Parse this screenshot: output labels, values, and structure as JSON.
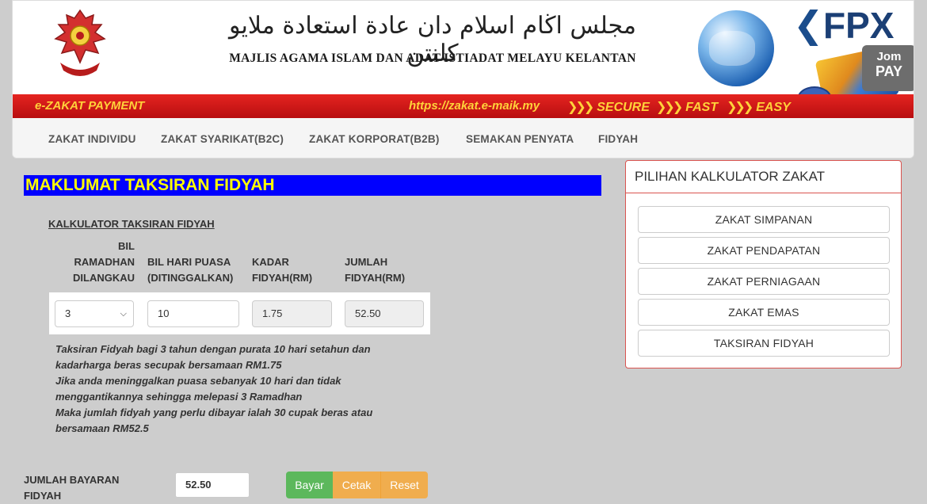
{
  "header": {
    "jawi_title": "مجلس اڬام اسلام دان عادة استعادة ملايو كلنتن",
    "org_name": "MAJLIS AGAMA ISLAM DAN ADAT ISTIADAT MELAYU KELANTAN",
    "fpx_text": "FPX",
    "jompay_line1": "Jom",
    "jompay_line2": "PAY",
    "strip_title": "e-ZAKAT PAYMENT",
    "strip_url": "https://zakat.e-maik.my",
    "strip_tags": [
      "SECURE",
      "FAST",
      "EASY"
    ]
  },
  "nav": {
    "items": [
      "ZAKAT INDIVIDU",
      "ZAKAT SYARIKAT(B2C)",
      "ZAKAT KORPORAT(B2B)",
      "SEMAKAN PENYATA",
      "FIDYAH"
    ]
  },
  "main": {
    "section_title": "MAKLUMAT TAKSIRAN FIDYAH",
    "calc_title": "KALKULATOR TAKSIRAN FIDYAH",
    "columns": {
      "ramadhan": [
        "BIL",
        "RAMADHAN",
        "DILANGKAU"
      ],
      "hari": [
        "BIL HARI PUASA",
        "(DITINGGALKAN)"
      ],
      "kadar": [
        "KADAR",
        "FIDYAH(RM)"
      ],
      "jumlah": [
        "JUMLAH",
        "FIDYAH(RM)"
      ]
    },
    "inputs": {
      "ramadhan_selected": "3",
      "hari_value": "10",
      "kadar_value": "1.75",
      "jumlah_value": "52.50"
    },
    "explanation": [
      "Taksiran Fidyah bagi 3 tahun dengan purata 10 hari setahun dan",
      "kadarharga beras secupak bersamaan RM1.75",
      "Jika anda meninggalkan puasa sebanyak 10 hari dan tidak",
      "menggantikannya sehingga melepasi 3 Ramadhan",
      "Maka jumlah fidyah yang perlu dibayar ialah 30 cupak beras atau",
      "bersamaan RM52.5"
    ],
    "payment": {
      "label_line1": "JUMLAH BAYARAN",
      "label_line2": "FIDYAH",
      "amount": "52.50",
      "bayar_label": "Bayar",
      "cetak_label": "Cetak",
      "reset_label": "Reset"
    }
  },
  "side_panel": {
    "title": "PILIHAN KALKULATOR ZAKAT",
    "buttons": [
      "ZAKAT SIMPANAN",
      "ZAKAT PENDAPATAN",
      "ZAKAT PERNIAGAAN",
      "ZAKAT EMAS",
      "TAKSIRAN FIDYAH"
    ]
  },
  "colors": {
    "section_bg": "#0000ff",
    "section_text": "#ffff00",
    "strip_red": "#d31b1b",
    "strip_text": "#ffd23a",
    "bayar_green": "#5cb85c",
    "cetak_orange": "#f0ad4e",
    "panel_border": "#d9534f"
  }
}
